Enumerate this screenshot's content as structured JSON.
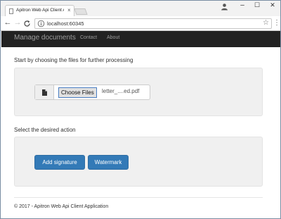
{
  "browser": {
    "tab_title": "Apitron Web Api Client A",
    "tab_close": "×",
    "url": "localhost:60345",
    "win_minimize": "–",
    "win_maximize": "☐",
    "win_close": "✕",
    "back": "←",
    "forward": "→",
    "reload": "C",
    "star": "☆",
    "menu": "⋮"
  },
  "navbar": {
    "brand": "Manage documents",
    "links": [
      "Contact",
      "About"
    ]
  },
  "upload": {
    "label": "Start by choosing the files for further processing",
    "choose_button": "Choose Files",
    "file_name": "letter_....ed.pdf"
  },
  "actions": {
    "label": "Select the desired action",
    "buttons": [
      "Add signature",
      "Watermark"
    ]
  },
  "footer": {
    "text": "© 2017 - Apitron Web Api Client Application"
  },
  "colors": {
    "navbar_bg": "#222222",
    "primary": "#337ab7",
    "well_bg": "#f0f0f0"
  }
}
